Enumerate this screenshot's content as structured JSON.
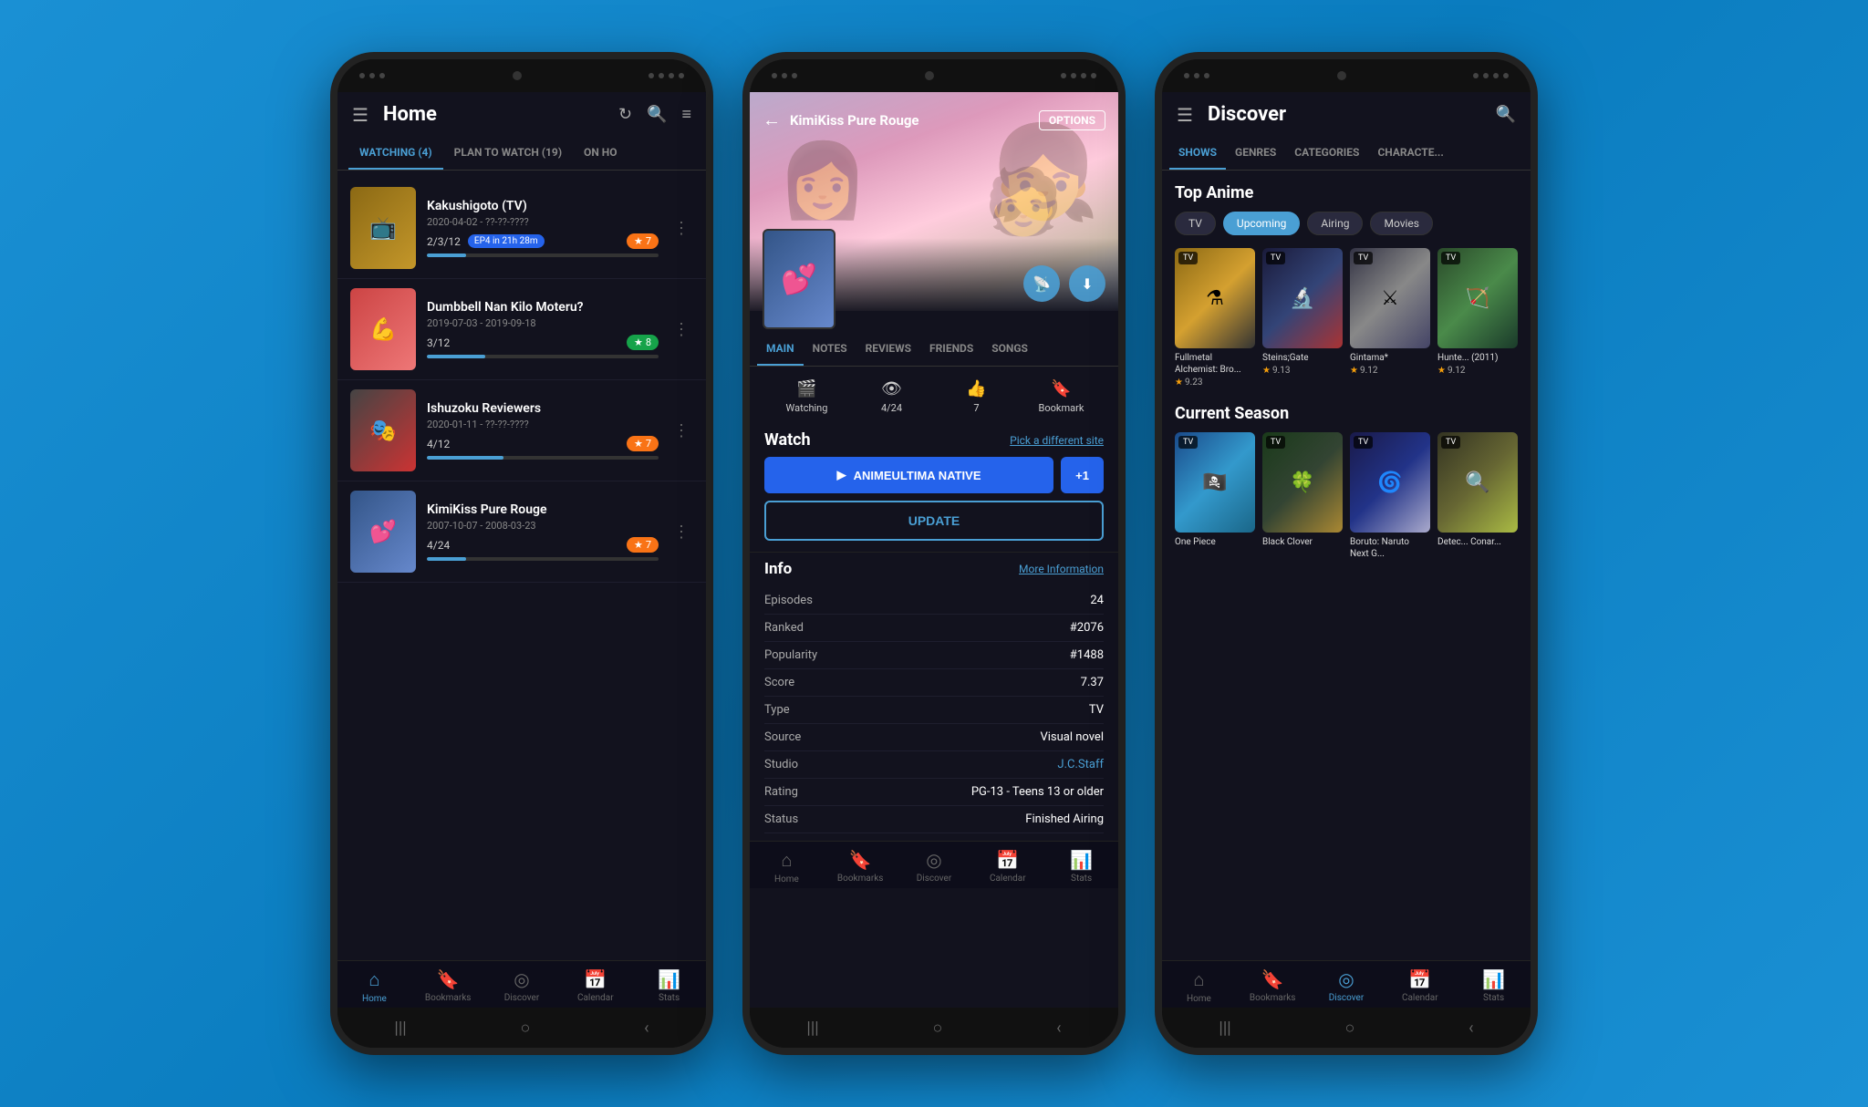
{
  "phone1": {
    "header": {
      "title": "Home",
      "menu_icon": "☰",
      "refresh_icon": "↻",
      "search_icon": "🔍",
      "filter_icon": "≡"
    },
    "tabs": [
      {
        "label": "WATCHING (4)",
        "active": true
      },
      {
        "label": "PLAN TO WATCH (19)",
        "active": false
      },
      {
        "label": "ON HO",
        "active": false
      }
    ],
    "anime_list": [
      {
        "title": "Kakushigoto (TV)",
        "dates": "2020-04-02 - ??-??-????",
        "progress": "2/3/12",
        "ep_badge": "EP4 in 21h 28m",
        "rating": "7",
        "rating_color": "orange",
        "progress_pct": 17
      },
      {
        "title": "Dumbbell Nan Kilo Moteru?",
        "dates": "2019-07-03 - 2019-09-18",
        "progress": "3/12",
        "ep_badge": null,
        "rating": "8",
        "rating_color": "green",
        "progress_pct": 25
      },
      {
        "title": "Ishuzoku Reviewers",
        "dates": "2020-01-11 - ??-??-????",
        "progress": "4/12",
        "ep_badge": null,
        "rating": "7",
        "rating_color": "orange",
        "progress_pct": 33
      },
      {
        "title": "KimiKiss Pure Rouge",
        "dates": "2007-10-07 - 2008-03-23",
        "progress": "4/24",
        "ep_badge": null,
        "rating": "7",
        "rating_color": "orange",
        "progress_pct": 17
      }
    ],
    "bottom_nav": [
      {
        "label": "Home",
        "icon": "⌂",
        "active": true
      },
      {
        "label": "Bookmarks",
        "icon": "🔖",
        "active": false
      },
      {
        "label": "Discover",
        "icon": "◎",
        "active": false
      },
      {
        "label": "Calendar",
        "icon": "📅",
        "active": false
      },
      {
        "label": "Stats",
        "icon": "📊",
        "active": false
      }
    ]
  },
  "phone2": {
    "header": {
      "back_icon": "←",
      "title": "KimiKiss Pure Rouge",
      "options_label": "OPTIONS"
    },
    "tabs": [
      {
        "label": "MAIN",
        "active": true
      },
      {
        "label": "NOTES",
        "active": false
      },
      {
        "label": "REVIEWS",
        "active": false
      },
      {
        "label": "FRIENDS",
        "active": false
      },
      {
        "label": "SONGS",
        "active": false
      }
    ],
    "stats": [
      {
        "icon": "🎬",
        "label": "Watching",
        "value": ""
      },
      {
        "icon": "👁",
        "label": "4/24",
        "value": ""
      },
      {
        "icon": "👍",
        "label": "7",
        "value": ""
      },
      {
        "icon": "🔖",
        "label": "Bookmark",
        "value": ""
      }
    ],
    "watch": {
      "title": "Watch",
      "pick_site": "Pick a different site",
      "primary_btn": "ANIMEULTIMA NATIVE",
      "plus_btn": "+1",
      "update_btn": "UPDATE"
    },
    "info": {
      "title": "Info",
      "more_link": "More Information",
      "rows": [
        {
          "key": "Episodes",
          "value": "24",
          "link": false
        },
        {
          "key": "Ranked",
          "value": "#2076",
          "link": false
        },
        {
          "key": "Popularity",
          "value": "#1488",
          "link": false
        },
        {
          "key": "Score",
          "value": "7.37",
          "link": false
        },
        {
          "key": "Type",
          "value": "TV",
          "link": false
        },
        {
          "key": "Source",
          "value": "Visual novel",
          "link": false
        },
        {
          "key": "Studio",
          "value": "J.C.Staff",
          "link": true
        },
        {
          "key": "Rating",
          "value": "PG-13 - Teens 13 or older",
          "link": false
        },
        {
          "key": "Status",
          "value": "Finished Airing",
          "link": false
        }
      ]
    },
    "bottom_nav": [
      {
        "label": "Home",
        "icon": "⌂",
        "active": false
      },
      {
        "label": "Bookmarks",
        "icon": "🔖",
        "active": false
      },
      {
        "label": "Discover",
        "icon": "◎",
        "active": false
      },
      {
        "label": "Calendar",
        "icon": "📅",
        "active": false
      },
      {
        "label": "Stats",
        "icon": "📊",
        "active": false
      }
    ]
  },
  "phone3": {
    "header": {
      "title": "Discover",
      "menu_icon": "☰",
      "search_icon": "🔍"
    },
    "tabs": [
      {
        "label": "SHOWS",
        "active": true
      },
      {
        "label": "GENRES",
        "active": false
      },
      {
        "label": "CATEGORIES",
        "active": false
      },
      {
        "label": "CHARACTE...",
        "active": false
      }
    ],
    "top_anime": {
      "section_title": "Top Anime",
      "filters": [
        {
          "label": "TV",
          "active": false
        },
        {
          "label": "Upcoming",
          "active": true
        },
        {
          "label": "Airing",
          "active": false
        },
        {
          "label": "Movies",
          "active": false
        }
      ],
      "items": [
        {
          "title": "Fullmetal Alchemist: Bro...",
          "rating": "9.23",
          "type": "TV",
          "bg": "bg-fma"
        },
        {
          "title": "Steins;Gate",
          "rating": "9.13",
          "type": "TV",
          "bg": "bg-steins"
        },
        {
          "title": "Gintama*",
          "rating": "9.12",
          "type": "TV",
          "bg": "bg-gintama"
        },
        {
          "title": "Hunte... (2011)",
          "rating": "9.12",
          "type": "TV",
          "bg": "bg-hunter"
        }
      ]
    },
    "current_season": {
      "section_title": "Current Season",
      "items": [
        {
          "title": "One Piece",
          "type": "TV",
          "bg": "bg-onepiece"
        },
        {
          "title": "Black Clover",
          "type": "TV",
          "bg": "bg-blackclover"
        },
        {
          "title": "Boruto: Naruto Next G...",
          "type": "TV",
          "bg": "bg-boruto"
        },
        {
          "title": "Detec... Conar...",
          "type": "TV",
          "bg": "bg-detective"
        }
      ]
    },
    "bottom_nav": [
      {
        "label": "Home",
        "icon": "⌂",
        "active": false
      },
      {
        "label": "Bookmarks",
        "icon": "🔖",
        "active": false
      },
      {
        "label": "Discover",
        "icon": "◎",
        "active": true
      },
      {
        "label": "Calendar",
        "icon": "📅",
        "active": false
      },
      {
        "label": "Stats",
        "icon": "📊",
        "active": false
      }
    ]
  }
}
